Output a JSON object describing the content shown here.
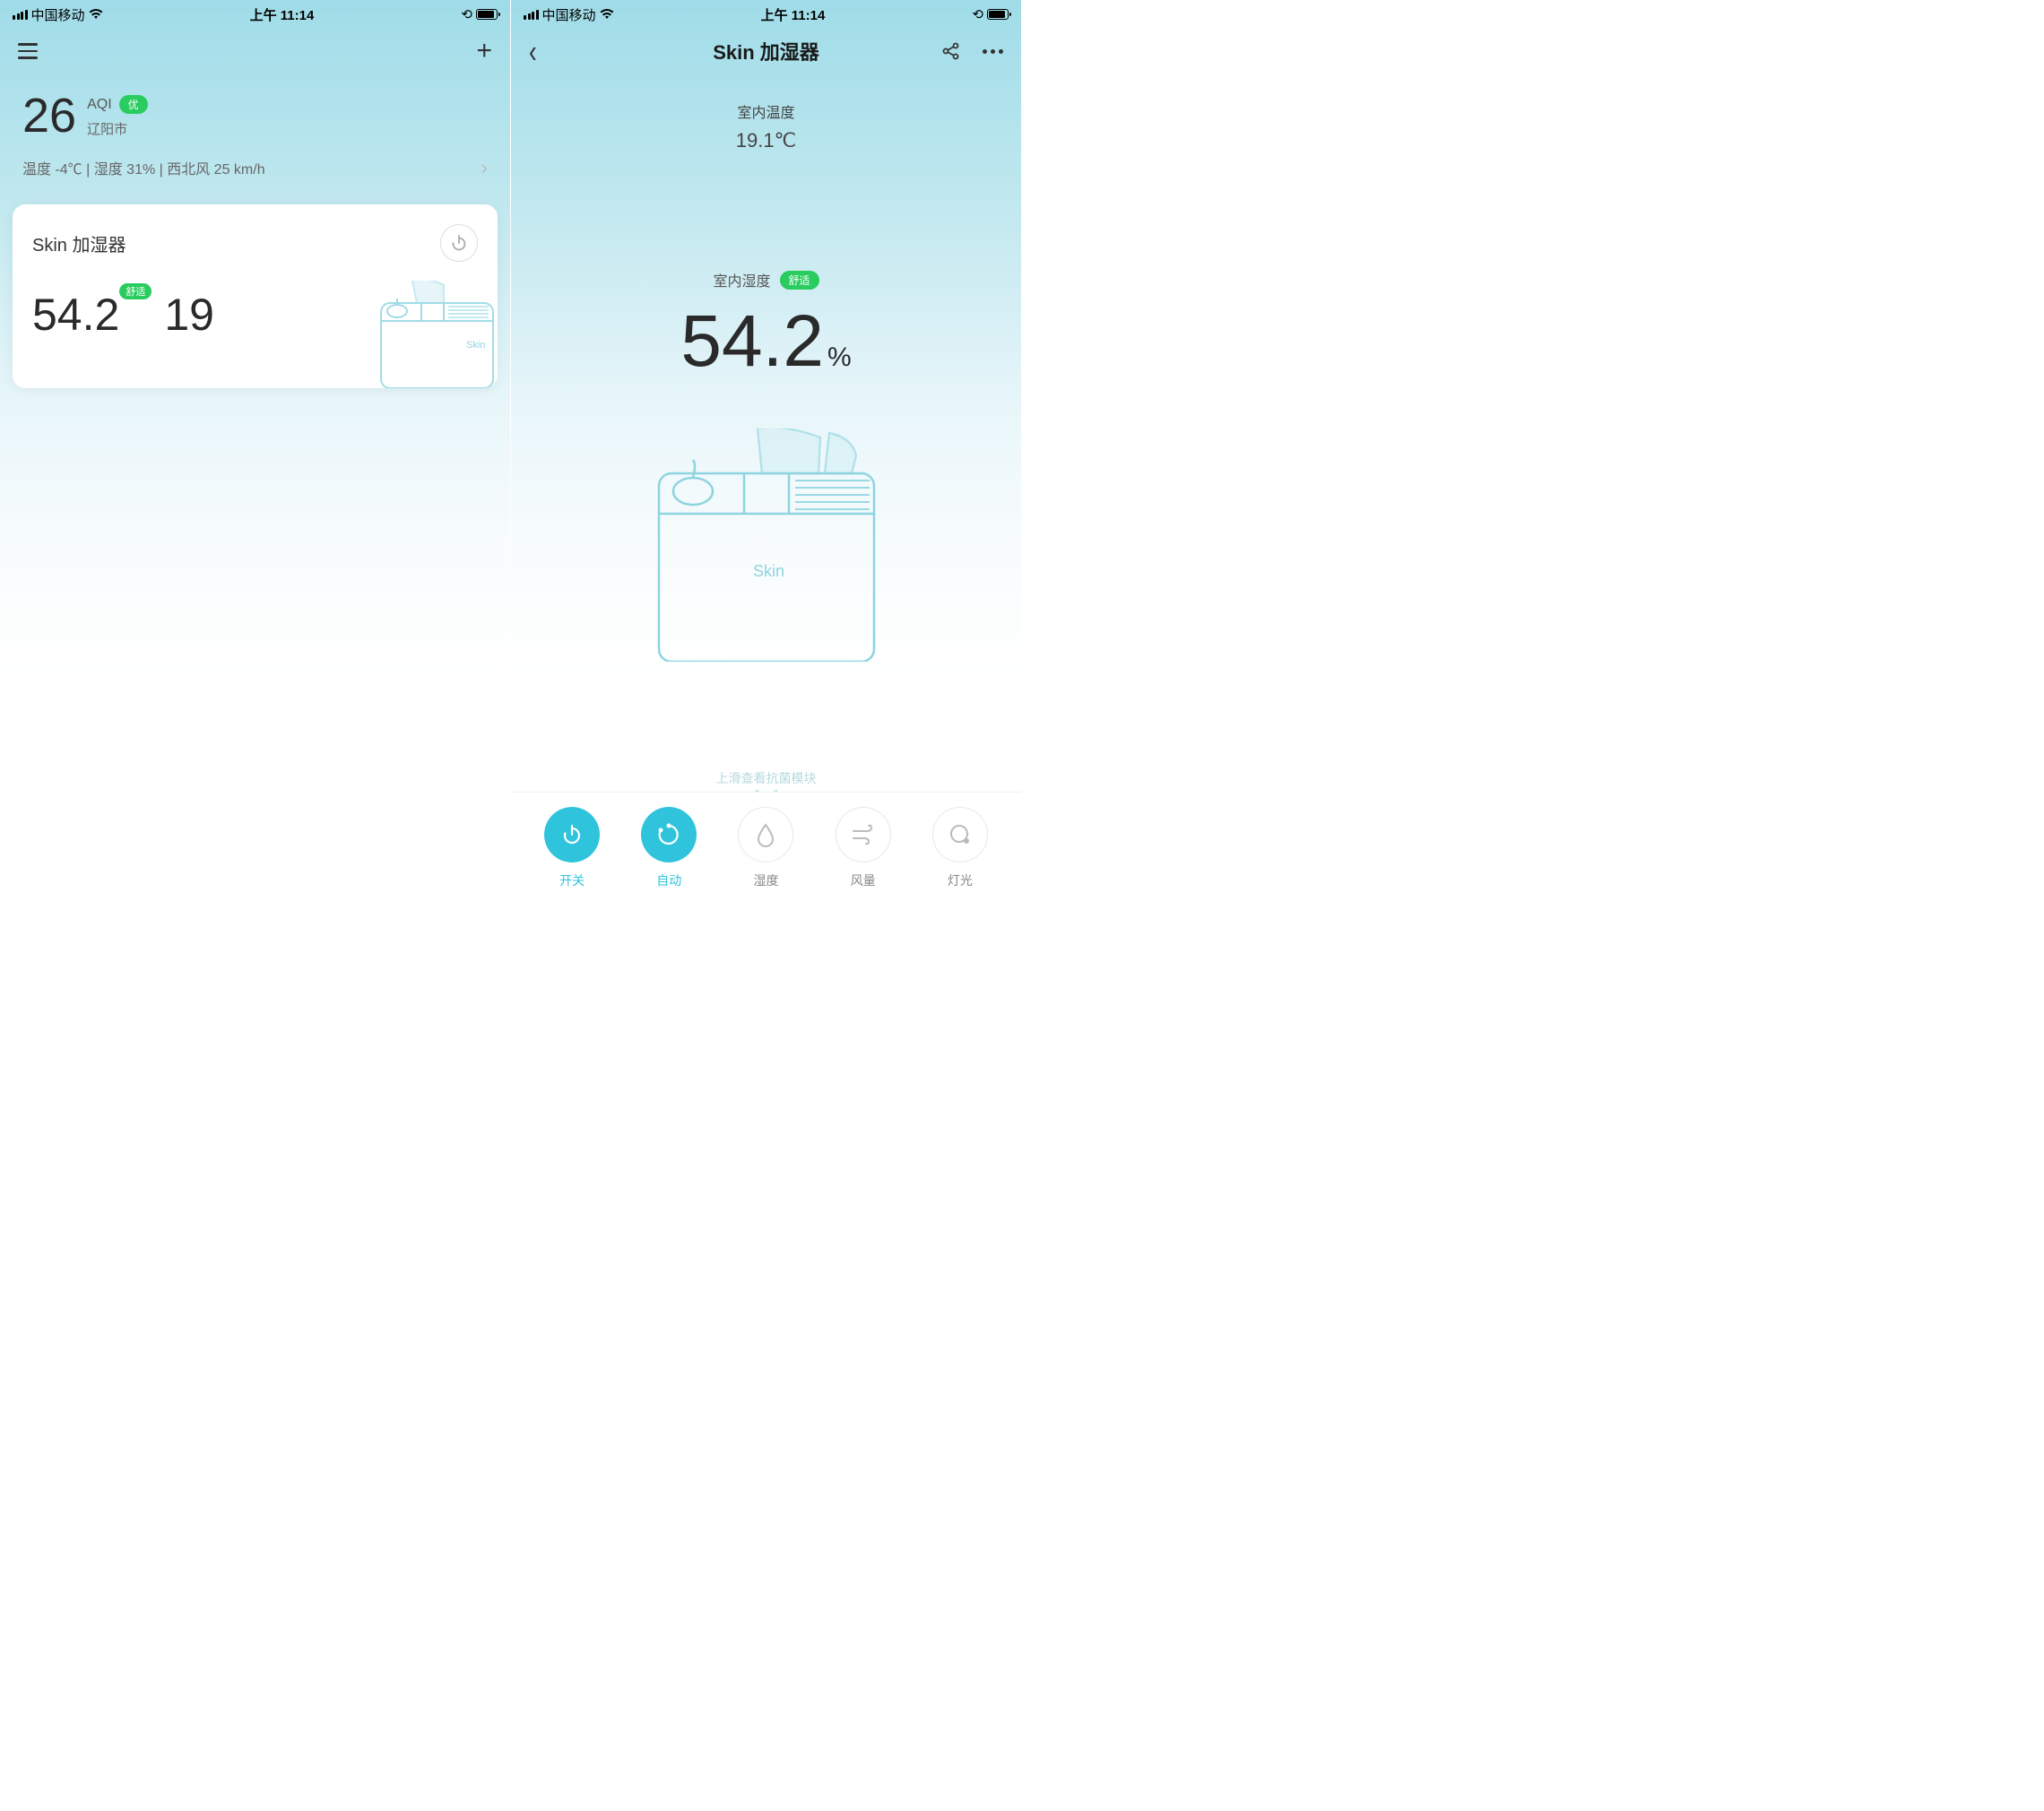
{
  "statusbar": {
    "carrier": "中国移动",
    "time": "上午 11:14"
  },
  "left": {
    "weather": {
      "aqi_value": "26",
      "aqi_label": "AQI",
      "aqi_badge": "优",
      "city": "辽阳市",
      "temp_label": "温度",
      "temp_value": "-4℃",
      "hum_label": "湿度",
      "hum_value": "31%",
      "wind_label": "西北风",
      "wind_value": "25 km/h",
      "detail_line": "温度 -4℃  |  湿度 31%  |  西北风 25 km/h"
    },
    "card": {
      "title": "Skin 加湿器",
      "humidity": "54.2",
      "hum_badge": "舒适",
      "temperature": "19"
    }
  },
  "right": {
    "title": "Skin 加湿器",
    "room_temp_label": "室内温度",
    "room_temp_value": "19.1℃",
    "room_hum_label": "室内湿度",
    "room_hum_badge": "舒适",
    "room_hum_value": "54.2",
    "room_hum_pct": "%",
    "device_brand": "Skin",
    "swipe_hint": "上滑查看抗菌模块",
    "actions": [
      {
        "key": "power",
        "label": "开关",
        "active": true
      },
      {
        "key": "auto",
        "label": "自动",
        "active": true
      },
      {
        "key": "humidity",
        "label": "湿度",
        "active": false
      },
      {
        "key": "wind",
        "label": "风量",
        "active": false
      },
      {
        "key": "light",
        "label": "灯光",
        "active": false
      }
    ]
  }
}
